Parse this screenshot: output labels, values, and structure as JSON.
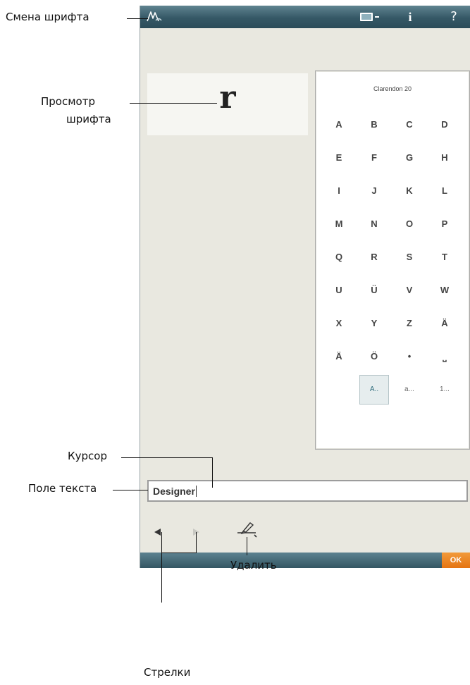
{
  "screen": {
    "preview_char": "r",
    "keyboard": {
      "title": "Clarendon 20",
      "keys": [
        "A",
        "B",
        "C",
        "D",
        "E",
        "F",
        "G",
        "H",
        "I",
        "J",
        "K",
        "L",
        "M",
        "N",
        "O",
        "P",
        "Q",
        "R",
        "S",
        "T",
        "U",
        "Ü",
        "V",
        "W",
        "X",
        "Y",
        "Z",
        "Ä",
        "Ä",
        "Ö",
        "•",
        "⎵"
      ],
      "mode_upper": "A..",
      "mode_lower": "a...",
      "mode_numbers": "1..."
    },
    "text_field_value": "Designer",
    "ok_label": "OK",
    "info_glyph": "i",
    "help_glyph": "?"
  },
  "annotations": {
    "font_change": "Смена шрифта",
    "font_preview_line1": "Просмотр",
    "font_preview_line2": "шрифта",
    "cursor": "Курсор",
    "text_field": "Поле текста",
    "delete": "Удалить",
    "arrows": "Стрелки"
  },
  "icons": {
    "font_change": "font-change-icon",
    "export": "export-icon",
    "info": "info-icon",
    "help": "help-icon",
    "arrow_left": "arrow-left-icon",
    "arrow_right": "arrow-right-icon",
    "delete": "delete-icon"
  },
  "colors": {
    "bar": "#355866",
    "ok": "#e47412",
    "screen_bg": "#e9e8e0"
  }
}
